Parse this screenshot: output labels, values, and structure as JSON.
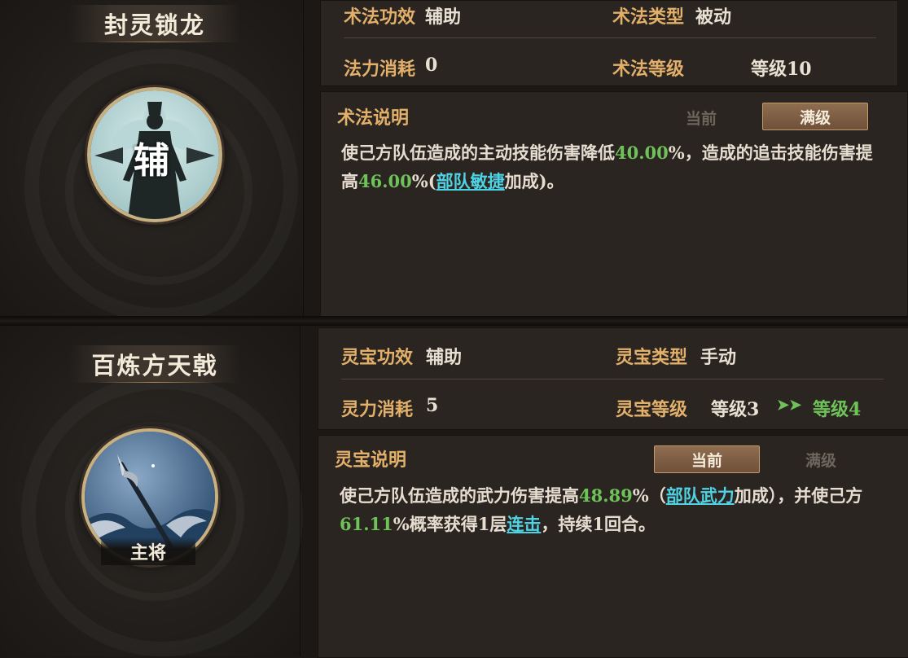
{
  "skill": {
    "name": "封灵锁龙",
    "emblem_char": "辅",
    "effect_label": "术法功效",
    "effect_value": "辅助",
    "type_label": "术法类型",
    "type_value": "被动",
    "cost_label": "法力消耗",
    "cost_value": "0",
    "level_label": "术法等级",
    "level_value": "等级10",
    "desc_title": "术法说明",
    "tab_current": "当前",
    "tab_max": "满级",
    "active_tab": "满级",
    "desc": {
      "p1": "使己方队伍造成的主动技能伤害降低",
      "n1": "40.00",
      "p2": "%，造成的追击技能伤害提高",
      "n2": "46.00",
      "p3": "%(",
      "link": "部队敏捷",
      "p4": "加成)。"
    }
  },
  "treasure": {
    "name": "百炼方天戟",
    "badge": "主将",
    "effect_label": "灵宝功效",
    "effect_value": "辅助",
    "type_label": "灵宝类型",
    "type_value": "手动",
    "cost_label": "灵力消耗",
    "cost_value": "5",
    "level_label": "灵宝等级",
    "level_value": "等级3",
    "level_arrow": "➤➤",
    "level_next": "等级4",
    "desc_title": "灵宝说明",
    "tab_current": "当前",
    "tab_max": "满级",
    "active_tab": "当前",
    "desc": {
      "p1": "使己方队伍造成的武力伤害提高",
      "n1": "48.89",
      "p2": "%（",
      "link1": "部队武力",
      "p3": "加成），并使己方",
      "n2": "61.11",
      "p4": "%概率获得1层",
      "link2": "连击",
      "p5": "，持续1回合。"
    }
  },
  "colors": {
    "label_gold": "#e2b06a",
    "value_green": "#6fc15a",
    "link_cyan": "#4fd2e3"
  }
}
